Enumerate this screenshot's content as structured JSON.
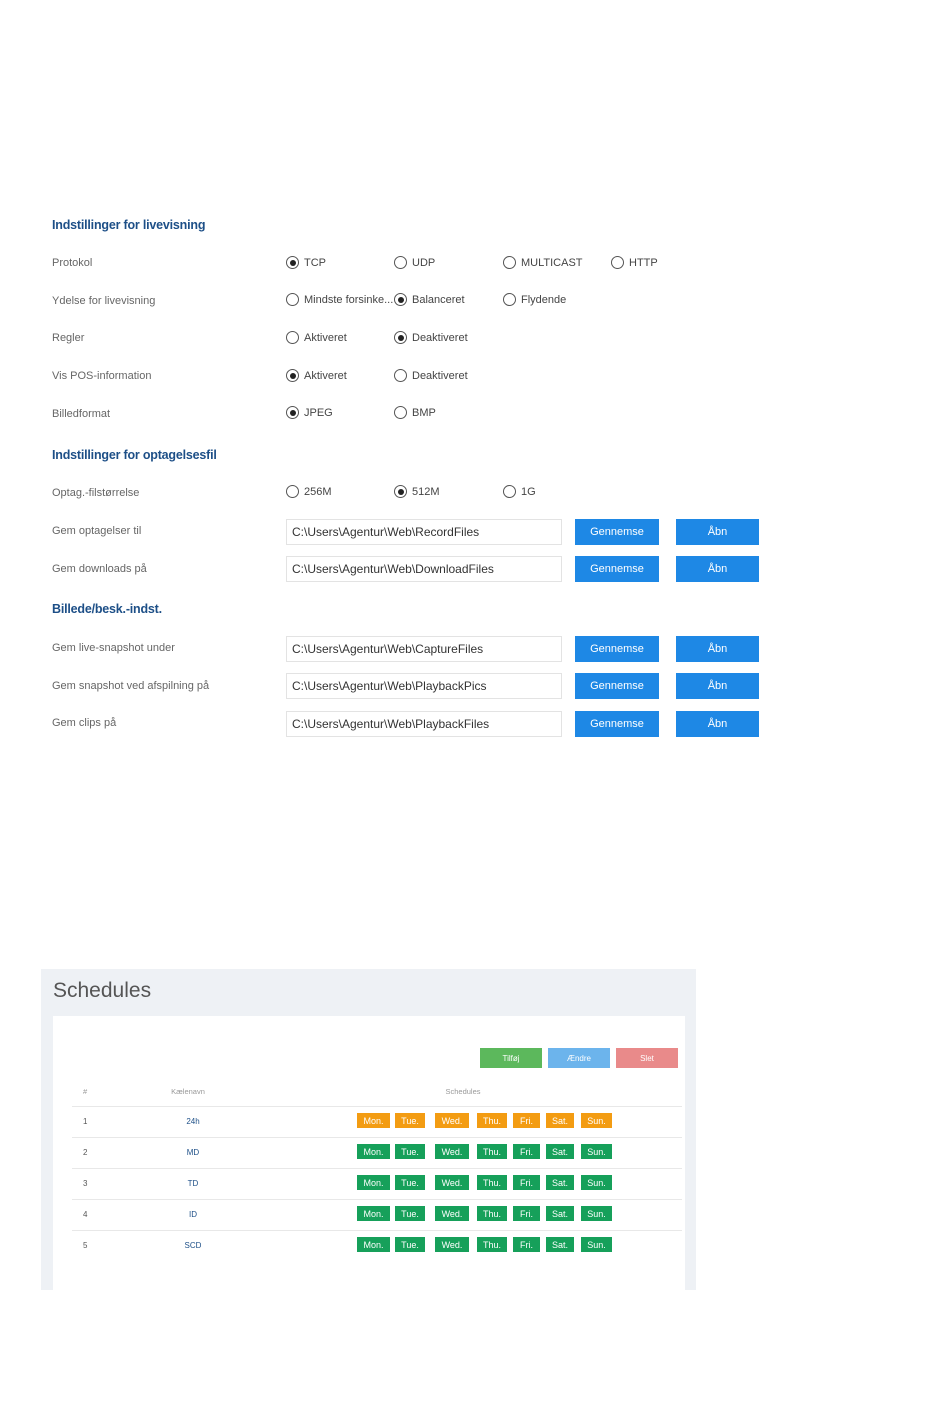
{
  "live_section": {
    "title": "Indstillinger for livevisning",
    "rows": [
      {
        "label": "Protokol",
        "options": [
          {
            "label": "TCP",
            "checked": true
          },
          {
            "label": "UDP",
            "checked": false
          },
          {
            "label": "MULTICAST",
            "checked": false
          },
          {
            "label": "HTTP",
            "checked": false
          }
        ]
      },
      {
        "label": "Ydelse for livevisning",
        "options": [
          {
            "label": "Mindste forsinke...",
            "checked": false
          },
          {
            "label": "Balanceret",
            "checked": true
          },
          {
            "label": "Flydende",
            "checked": false
          }
        ]
      },
      {
        "label": "Regler",
        "options": [
          {
            "label": "Aktiveret",
            "checked": false
          },
          {
            "label": "Deaktiveret",
            "checked": true
          }
        ]
      },
      {
        "label": "Vis POS-information",
        "options": [
          {
            "label": "Aktiveret",
            "checked": true
          },
          {
            "label": "Deaktiveret",
            "checked": false
          }
        ]
      },
      {
        "label": "Billedformat",
        "options": [
          {
            "label": "JPEG",
            "checked": true
          },
          {
            "label": "BMP",
            "checked": false
          }
        ]
      }
    ]
  },
  "record_section": {
    "title": "Indstillinger for optagelsesfil",
    "size_row": {
      "label": "Optag.-filstørrelse",
      "options": [
        {
          "label": "256M",
          "checked": false
        },
        {
          "label": "512M",
          "checked": true
        },
        {
          "label": "1G",
          "checked": false
        }
      ]
    },
    "paths": [
      {
        "label": "Gem optagelser til",
        "value": "C:\\Users\\Agentur\\Web\\RecordFiles",
        "browse": "Gennemse",
        "open": "Åbn"
      },
      {
        "label": "Gem downloads på",
        "value": "C:\\Users\\Agentur\\Web\\DownloadFiles",
        "browse": "Gennemse",
        "open": "Åbn"
      }
    ]
  },
  "picture_section": {
    "title": "Billede/besk.-indst.",
    "paths": [
      {
        "label": "Gem live-snapshot under",
        "value": "C:\\Users\\Agentur\\Web\\CaptureFiles",
        "browse": "Gennemse",
        "open": "Åbn"
      },
      {
        "label": "Gem snapshot ved afspilning på",
        "value": "C:\\Users\\Agentur\\Web\\PlaybackPics",
        "browse": "Gennemse",
        "open": "Åbn"
      },
      {
        "label": "Gem clips på",
        "value": "C:\\Users\\Agentur\\Web\\PlaybackFiles",
        "browse": "Gennemse",
        "open": "Åbn"
      }
    ]
  },
  "schedules": {
    "title": "Schedules",
    "buttons": {
      "add": "Tilføj",
      "edit": "Ændre",
      "delete": "Slet"
    },
    "headers": {
      "num": "#",
      "name": "Kælenavn",
      "schedules": "Schedules"
    },
    "rows": [
      {
        "num": "1",
        "name": "24h",
        "days": [
          "Mon.",
          "Tue.",
          "Wed.",
          "Thu.",
          "Fri.",
          "Sat.",
          "Sun."
        ],
        "color": "#f39c12"
      },
      {
        "num": "2",
        "name": "MD",
        "days": [
          "Mon.",
          "Tue.",
          "Wed.",
          "Thu.",
          "Fri.",
          "Sat.",
          "Sun."
        ],
        "color": "#16a05a"
      },
      {
        "num": "3",
        "name": "TD",
        "days": [
          "Mon.",
          "Tue.",
          "Wed.",
          "Thu.",
          "Fri.",
          "Sat.",
          "Sun."
        ],
        "color": "#16a05a"
      },
      {
        "num": "4",
        "name": "ID",
        "days": [
          "Mon.",
          "Tue.",
          "Wed.",
          "Thu.",
          "Fri.",
          "Sat.",
          "Sun."
        ],
        "color": "#16a05a"
      },
      {
        "num": "5",
        "name": "SCD",
        "days": [
          "Mon.",
          "Tue.",
          "Wed.",
          "Thu.",
          "Fri.",
          "Sat.",
          "Sun."
        ],
        "color": "#16a05a"
      }
    ],
    "colors": {
      "add": "#5cb85c",
      "edit": "#6cb4ec",
      "delete": "#e98a8a"
    }
  }
}
